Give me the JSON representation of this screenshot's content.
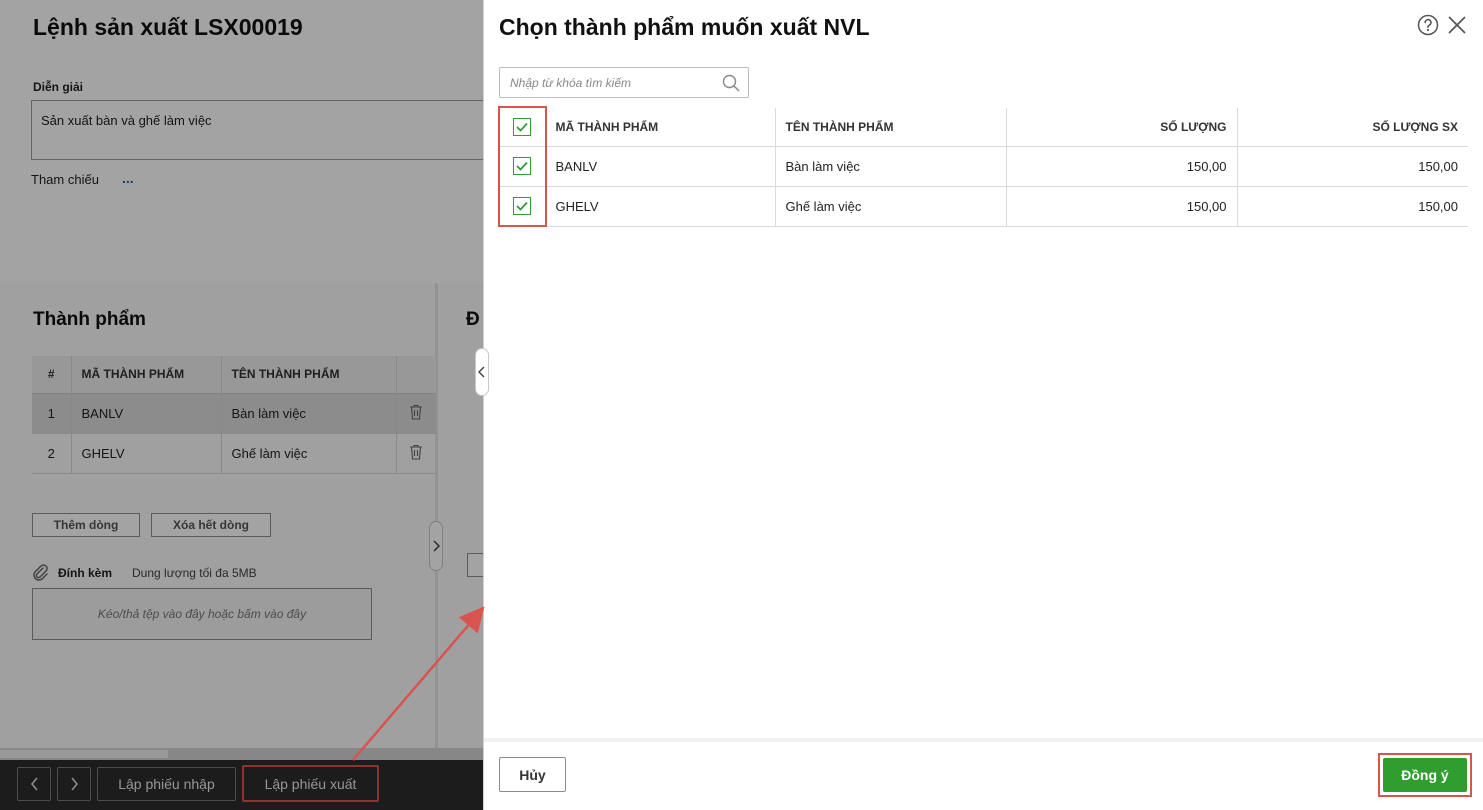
{
  "background": {
    "title": "Lệnh sản xuất LSX00019",
    "description_label": "Diễn giải",
    "description_value": "Sản xuất bàn và ghế làm việc",
    "reference_label": "Tham chiếu",
    "reference_link": "...",
    "products_section_title": "Thành phẩm",
    "materials_section_title_partial": "Đ",
    "products_table": {
      "headers": [
        "#",
        "MÃ THÀNH PHẨM",
        "TÊN THÀNH PHẨM"
      ],
      "rows": [
        {
          "index": "1",
          "code": "BANLV",
          "name": "Bàn làm việc"
        },
        {
          "index": "2",
          "code": "GHELV",
          "name": "Ghế làm việc"
        }
      ]
    },
    "add_row_label": "Thêm dòng",
    "clear_rows_label": "Xóa hết dòng",
    "attachment_label": "Đính kèm",
    "attachment_limit": "Dung lượng tối đa 5MB",
    "dropzone_text": "Kéo/thả tệp vào đây hoặc bấm vào đây",
    "footer": {
      "import_label": "Lập phiếu nhập",
      "export_label": "Lập phiếu xuất"
    }
  },
  "modal": {
    "title": "Chọn thành phẩm muốn xuất NVL",
    "search_placeholder": "Nhập từ khóa tìm kiếm",
    "table": {
      "headers": [
        "MÃ THÀNH PHẨM",
        "TÊN THÀNH PHẨM",
        "SỐ LƯỢNG",
        "SỐ LƯỢNG SX"
      ],
      "rows": [
        {
          "code": "BANLV",
          "name": "Bàn làm việc",
          "qty": "150,00",
          "qty_sx": "150,00",
          "checked": true
        },
        {
          "code": "GHELV",
          "name": "Ghế làm việc",
          "qty": "150,00",
          "qty_sx": "150,00",
          "checked": true
        }
      ]
    },
    "cancel_label": "Hủy",
    "ok_label": "Đồng ý"
  },
  "colors": {
    "accent_green": "#2f9e2f",
    "annotation_red": "#d9534f",
    "footer_dark": "#2c2c2c"
  }
}
